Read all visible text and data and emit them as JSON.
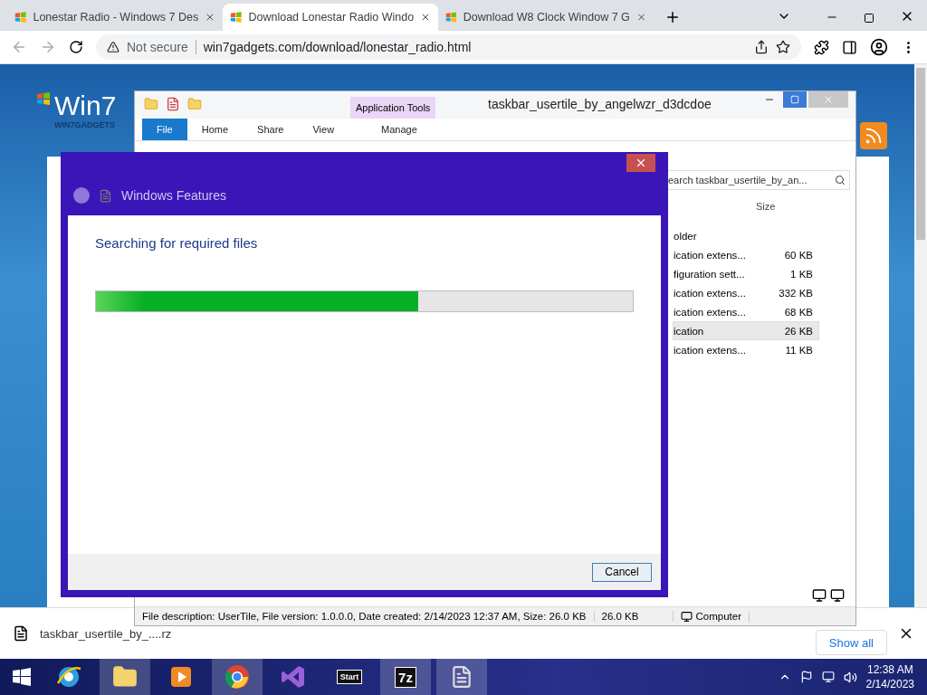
{
  "browser": {
    "tabs": [
      {
        "title": "Lonestar Radio - Windows 7 Des",
        "selected": false
      },
      {
        "title": "Download Lonestar Radio Windo",
        "selected": true
      },
      {
        "title": "Download W8 Clock Window 7 G",
        "selected": false
      }
    ],
    "address": {
      "security": "Not secure",
      "url": "win7gadgets.com/download/lonestar_radio.html"
    }
  },
  "website": {
    "logo": "Win7",
    "tagline": "WIN7GADGETS"
  },
  "explorer": {
    "title": "taskbar_usertile_by_angelwzr_d3dcdoe",
    "context_group": "Application Tools",
    "ribbon_tabs": [
      {
        "label": "File",
        "selected": true
      },
      {
        "label": "Home",
        "selected": false
      },
      {
        "label": "Share",
        "selected": false
      },
      {
        "label": "View",
        "selected": false
      },
      {
        "label": "Manage",
        "selected": false
      }
    ],
    "search": {
      "placeholder": "earch taskbar_usertile_by_an..."
    },
    "columns": [
      "Size"
    ],
    "rows": [
      {
        "type": "older",
        "selected": false
      },
      {
        "type": "ication extens...",
        "size": "60 KB",
        "selected": false
      },
      {
        "type": "figuration sett...",
        "size": "1 KB",
        "selected": false
      },
      {
        "type": "ication extens...",
        "size": "332 KB",
        "selected": false
      },
      {
        "type": "ication extens...",
        "size": "68 KB",
        "selected": false
      },
      {
        "type": "ication",
        "size": "26 KB",
        "selected": true
      },
      {
        "type": "ication extens...",
        "size": "11 KB",
        "selected": false
      }
    ],
    "status": {
      "description": "File description: UserTile, File version: 1.0.0.0, Date created: 2/14/2023 12:37 AM, Size: 26.0 KB",
      "size": "26.0 KB",
      "location": "Computer"
    }
  },
  "dialog": {
    "title": "Windows Features",
    "heading": "Searching for required files",
    "progress": {
      "level": 0.6
    },
    "button": "Cancel"
  },
  "download_bar": {
    "file": "taskbar_usertile_by_....rz",
    "action": "Show all"
  },
  "taskbar": {
    "apps": [
      {
        "kind": "ie",
        "running": false
      },
      {
        "kind": "explorer",
        "running": true
      },
      {
        "kind": "media",
        "running": false
      },
      {
        "kind": "chrome",
        "running": true
      },
      {
        "kind": "vs",
        "running": false
      },
      {
        "kind": "start",
        "label": "Start",
        "running": false
      },
      {
        "kind": "zip",
        "label": "7z",
        "running": true
      },
      {
        "kind": "features",
        "running": true
      }
    ],
    "time": "12:38 AM",
    "date": "2/14/2023"
  }
}
